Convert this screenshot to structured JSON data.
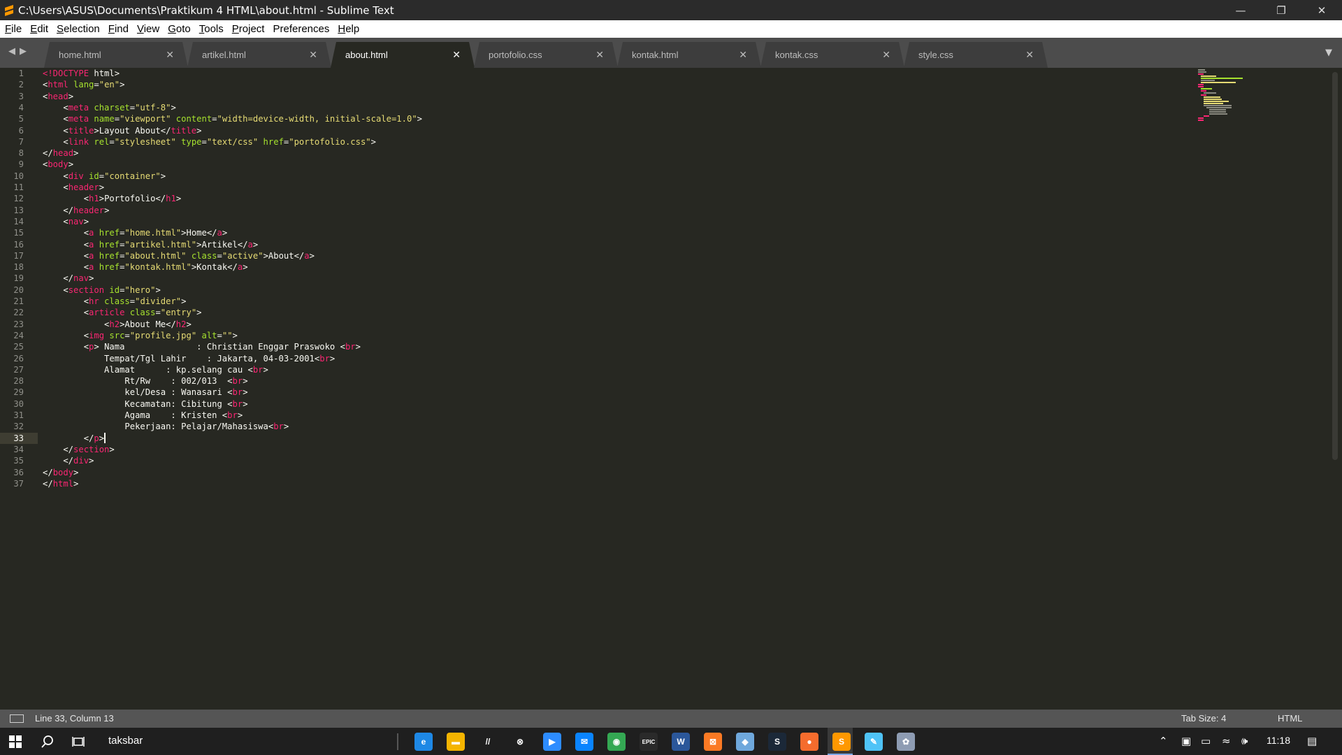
{
  "window": {
    "title": "C:\\Users\\ASUS\\Documents\\Praktikum 4 HTML\\about.html - Sublime Text",
    "controls": [
      "minimize",
      "restore",
      "close"
    ]
  },
  "menu": {
    "items": [
      {
        "label": "File",
        "u": "F",
        "rest": "ile"
      },
      {
        "label": "Edit",
        "u": "E",
        "rest": "dit"
      },
      {
        "label": "Selection",
        "u": "S",
        "rest": "election"
      },
      {
        "label": "Find",
        "u": "F",
        "rest": "ind"
      },
      {
        "label": "View",
        "u": "V",
        "rest": "iew"
      },
      {
        "label": "Goto",
        "u": "G",
        "rest": "oto"
      },
      {
        "label": "Tools",
        "u": "T",
        "rest": "ools"
      },
      {
        "label": "Project",
        "u": "P",
        "rest": "roject"
      },
      {
        "label": "Preferences",
        "u": "",
        "rest": "Preferences"
      },
      {
        "label": "Help",
        "u": "H",
        "rest": "elp"
      }
    ]
  },
  "tabs": [
    {
      "label": "home.html",
      "active": false
    },
    {
      "label": "artikel.html",
      "active": false
    },
    {
      "label": "about.html",
      "active": true
    },
    {
      "label": "portofolio.css",
      "active": false
    },
    {
      "label": "kontak.html",
      "active": false
    },
    {
      "label": "kontak.css",
      "active": false
    },
    {
      "label": "style.css",
      "active": false
    }
  ],
  "editor": {
    "current_line": 33,
    "lines": [
      [
        [
          "t",
          "<!DOCTYPE"
        ],
        [
          "w",
          " html>"
        ]
      ],
      [
        [
          "w",
          "<"
        ],
        [
          "t",
          "html"
        ],
        [
          "a",
          " lang"
        ],
        [
          "w",
          "="
        ],
        [
          "s",
          "\"en\""
        ],
        [
          "w",
          ">"
        ]
      ],
      [
        [
          "w",
          "<"
        ],
        [
          "t",
          "head"
        ],
        [
          "w",
          ">"
        ]
      ],
      [
        [
          "w",
          "    <"
        ],
        [
          "t",
          "meta"
        ],
        [
          "a",
          " charset"
        ],
        [
          "w",
          "="
        ],
        [
          "s",
          "\"utf-8\""
        ],
        [
          "w",
          ">"
        ]
      ],
      [
        [
          "w",
          "    <"
        ],
        [
          "t",
          "meta"
        ],
        [
          "a",
          " name"
        ],
        [
          "w",
          "="
        ],
        [
          "s",
          "\"viewport\""
        ],
        [
          "a",
          " content"
        ],
        [
          "w",
          "="
        ],
        [
          "s",
          "\"width=device-width, initial-scale=1.0\""
        ],
        [
          "w",
          ">"
        ]
      ],
      [
        [
          "w",
          "    <"
        ],
        [
          "t",
          "title"
        ],
        [
          "w",
          ">Layout About</"
        ],
        [
          "t",
          "title"
        ],
        [
          "w",
          ">"
        ]
      ],
      [
        [
          "w",
          "    <"
        ],
        [
          "t",
          "link"
        ],
        [
          "a",
          " rel"
        ],
        [
          "w",
          "="
        ],
        [
          "s",
          "\"stylesheet\""
        ],
        [
          "a",
          " type"
        ],
        [
          "w",
          "="
        ],
        [
          "s",
          "\"text/css\""
        ],
        [
          "a",
          " href"
        ],
        [
          "w",
          "="
        ],
        [
          "s",
          "\"portofolio.css\""
        ],
        [
          "w",
          ">"
        ]
      ],
      [
        [
          "w",
          "</"
        ],
        [
          "t",
          "head"
        ],
        [
          "w",
          ">"
        ]
      ],
      [
        [
          "w",
          "<"
        ],
        [
          "t",
          "body"
        ],
        [
          "w",
          ">"
        ]
      ],
      [
        [
          "w",
          "    <"
        ],
        [
          "t",
          "div"
        ],
        [
          "a",
          " id"
        ],
        [
          "w",
          "="
        ],
        [
          "s",
          "\"container\""
        ],
        [
          "w",
          ">"
        ]
      ],
      [
        [
          "w",
          "    <"
        ],
        [
          "t",
          "header"
        ],
        [
          "w",
          ">"
        ]
      ],
      [
        [
          "w",
          "        <"
        ],
        [
          "t",
          "h1"
        ],
        [
          "w",
          ">Portofolio</"
        ],
        [
          "t",
          "h1"
        ],
        [
          "w",
          ">"
        ]
      ],
      [
        [
          "w",
          "    </"
        ],
        [
          "t",
          "header"
        ],
        [
          "w",
          ">"
        ]
      ],
      [
        [
          "w",
          "    <"
        ],
        [
          "t",
          "nav"
        ],
        [
          "w",
          ">"
        ]
      ],
      [
        [
          "w",
          "        <"
        ],
        [
          "t",
          "a"
        ],
        [
          "a",
          " href"
        ],
        [
          "w",
          "="
        ],
        [
          "s",
          "\"home.html\""
        ],
        [
          "w",
          ">Home</"
        ],
        [
          "t",
          "a"
        ],
        [
          "w",
          ">"
        ]
      ],
      [
        [
          "w",
          "        <"
        ],
        [
          "t",
          "a"
        ],
        [
          "a",
          " href"
        ],
        [
          "w",
          "="
        ],
        [
          "s",
          "\"artikel.html\""
        ],
        [
          "w",
          ">Artikel</"
        ],
        [
          "t",
          "a"
        ],
        [
          "w",
          ">"
        ]
      ],
      [
        [
          "w",
          "        <"
        ],
        [
          "t",
          "a"
        ],
        [
          "a",
          " href"
        ],
        [
          "w",
          "="
        ],
        [
          "s",
          "\"about.html\""
        ],
        [
          "a",
          " class"
        ],
        [
          "w",
          "="
        ],
        [
          "s",
          "\"active\""
        ],
        [
          "w",
          ">About</"
        ],
        [
          "t",
          "a"
        ],
        [
          "w",
          ">"
        ]
      ],
      [
        [
          "w",
          "        <"
        ],
        [
          "t",
          "a"
        ],
        [
          "a",
          " href"
        ],
        [
          "w",
          "="
        ],
        [
          "s",
          "\"kontak.html\""
        ],
        [
          "w",
          ">Kontak</"
        ],
        [
          "t",
          "a"
        ],
        [
          "w",
          ">"
        ]
      ],
      [
        [
          "w",
          "    </"
        ],
        [
          "t",
          "nav"
        ],
        [
          "w",
          ">"
        ]
      ],
      [
        [
          "w",
          "    <"
        ],
        [
          "t",
          "section"
        ],
        [
          "a",
          " id"
        ],
        [
          "w",
          "="
        ],
        [
          "s",
          "\"hero\""
        ],
        [
          "w",
          ">"
        ]
      ],
      [
        [
          "w",
          "        <"
        ],
        [
          "t",
          "hr"
        ],
        [
          "a",
          " class"
        ],
        [
          "w",
          "="
        ],
        [
          "s",
          "\"divider\""
        ],
        [
          "w",
          ">"
        ]
      ],
      [
        [
          "w",
          "        <"
        ],
        [
          "t",
          "article"
        ],
        [
          "a",
          " class"
        ],
        [
          "w",
          "="
        ],
        [
          "s",
          "\"entry\""
        ],
        [
          "w",
          ">"
        ]
      ],
      [
        [
          "w",
          "            <"
        ],
        [
          "t",
          "h2"
        ],
        [
          "w",
          ">About Me</"
        ],
        [
          "t",
          "h2"
        ],
        [
          "w",
          ">"
        ]
      ],
      [
        [
          "w",
          "        <"
        ],
        [
          "t",
          "img"
        ],
        [
          "a",
          " src"
        ],
        [
          "w",
          "="
        ],
        [
          "s",
          "\"profile.jpg\""
        ],
        [
          "a",
          " alt"
        ],
        [
          "w",
          "="
        ],
        [
          "s",
          "\"\""
        ],
        [
          "w",
          ">"
        ]
      ],
      [
        [
          "w",
          "        <"
        ],
        [
          "t",
          "p"
        ],
        [
          "w",
          "> Nama              : Christian Enggar Praswoko <"
        ],
        [
          "t",
          "br"
        ],
        [
          "w",
          ">"
        ]
      ],
      [
        [
          "w",
          "            Tempat/Tgl Lahir    : Jakarta, 04-03-2001<"
        ],
        [
          "t",
          "br"
        ],
        [
          "w",
          ">"
        ]
      ],
      [
        [
          "w",
          "            Alamat      : kp.selang cau <"
        ],
        [
          "t",
          "br"
        ],
        [
          "w",
          ">"
        ]
      ],
      [
        [
          "w",
          "                Rt/Rw    : 002/013  <"
        ],
        [
          "t",
          "br"
        ],
        [
          "w",
          ">"
        ]
      ],
      [
        [
          "w",
          "                kel/Desa : Wanasari <"
        ],
        [
          "t",
          "br"
        ],
        [
          "w",
          ">"
        ]
      ],
      [
        [
          "w",
          "                Kecamatan: Cibitung <"
        ],
        [
          "t",
          "br"
        ],
        [
          "w",
          ">"
        ]
      ],
      [
        [
          "w",
          "                Agama    : Kristen <"
        ],
        [
          "t",
          "br"
        ],
        [
          "w",
          ">"
        ]
      ],
      [
        [
          "w",
          "                Pekerjaan: Pelajar/Mahasiswa<"
        ],
        [
          "t",
          "br"
        ],
        [
          "w",
          ">"
        ]
      ],
      [
        [
          "w",
          "        </"
        ],
        [
          "t",
          "p"
        ],
        [
          "w",
          ">"
        ]
      ],
      [
        [
          "w",
          "    </"
        ],
        [
          "t",
          "section"
        ],
        [
          "w",
          ">"
        ]
      ],
      [
        [
          "w",
          "    </"
        ],
        [
          "t",
          "div"
        ],
        [
          "w",
          ">"
        ]
      ],
      [
        [
          "w",
          "</"
        ],
        [
          "t",
          "body"
        ],
        [
          "w",
          ">"
        ]
      ],
      [
        [
          "w",
          "</"
        ],
        [
          "t",
          "html"
        ],
        [
          "w",
          ">"
        ]
      ]
    ]
  },
  "status": {
    "position": "Line 33, Column 13",
    "tab_size": "Tab Size: 4",
    "syntax": "HTML"
  },
  "taskbar": {
    "search_text": "taksbar",
    "clock": "11:18",
    "apps": [
      {
        "icon": "edge-icon",
        "color": "#1e88e5",
        "glyph": "e"
      },
      {
        "icon": "file-explorer-icon",
        "color": "#f4b400",
        "glyph": "▬"
      },
      {
        "icon": "pen-app-icon",
        "color": "#1f1f1f",
        "glyph": "//"
      },
      {
        "icon": "xbox-icon",
        "color": "#1f1f1f",
        "glyph": "⊗"
      },
      {
        "icon": "zoom-icon",
        "color": "#2d8cff",
        "glyph": "▶"
      },
      {
        "icon": "mail-icon",
        "color": "#0a84ff",
        "glyph": "✉"
      },
      {
        "icon": "chrome-icon",
        "color": "#34a853",
        "glyph": "◉"
      },
      {
        "icon": "epic-games-icon",
        "color": "#2a2a2a",
        "glyph": "EPIC"
      },
      {
        "icon": "word-icon",
        "color": "#2b579a",
        "glyph": "W"
      },
      {
        "icon": "xampp-icon",
        "color": "#fb7a24",
        "glyph": "⊠"
      },
      {
        "icon": "virtualbox-icon",
        "color": "#6fa8dc",
        "glyph": "◆"
      },
      {
        "icon": "steam-icon",
        "color": "#1b2838",
        "glyph": "S"
      },
      {
        "icon": "origin-icon",
        "color": "#f56c2d",
        "glyph": "●"
      },
      {
        "icon": "sublime-text-icon",
        "color": "#ff9800",
        "glyph": "S"
      },
      {
        "icon": "notepad-icon",
        "color": "#4fc3f7",
        "glyph": "✎"
      },
      {
        "icon": "paint-icon",
        "color": "#8e9cb3",
        "glyph": "✿"
      }
    ]
  },
  "colors": {
    "editor_bg": "#272822",
    "tag": "#f92672",
    "attr": "#a6e22e",
    "string": "#e6db74",
    "text": "#f8f8f2"
  }
}
